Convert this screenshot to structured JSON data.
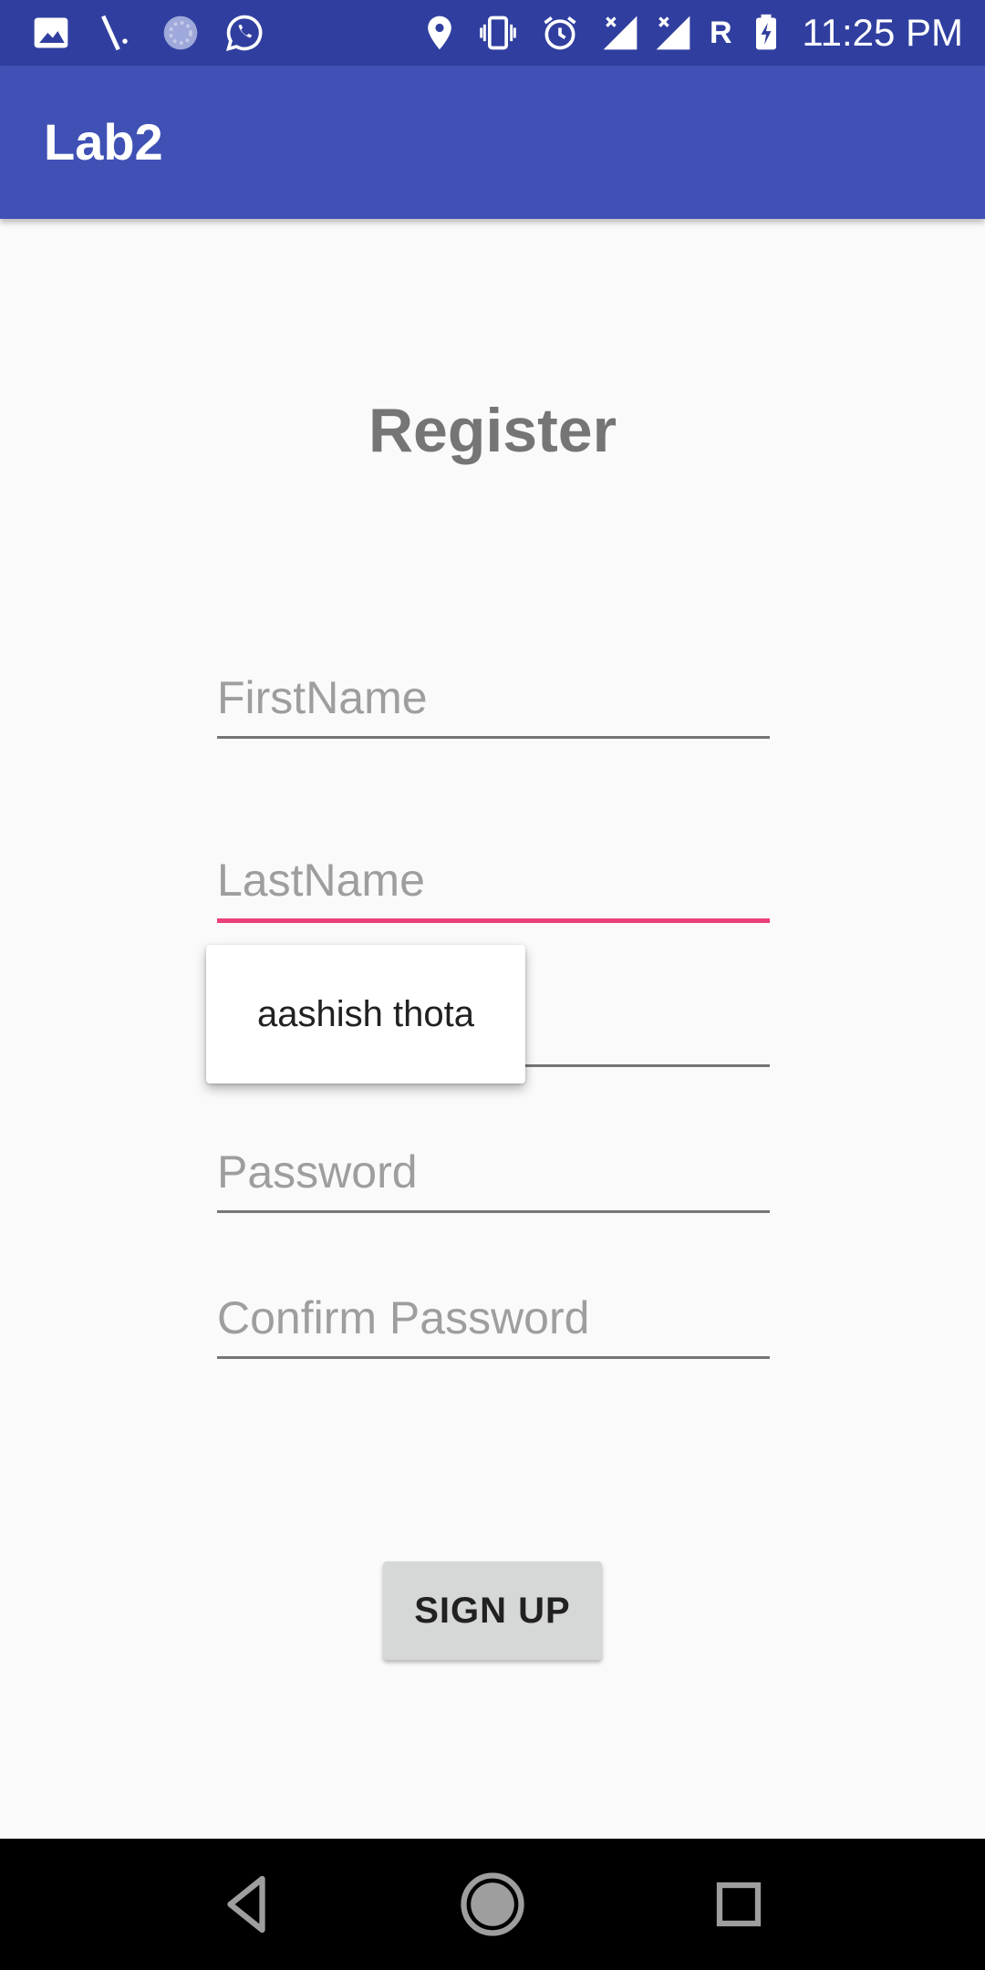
{
  "status_bar": {
    "time": "11:25 PM",
    "carrier_letter": "R",
    "icons": [
      "image-icon",
      "tool-icon",
      "sync-icon",
      "whatsapp-icon",
      "location-icon",
      "vibrate-icon",
      "alarm-icon",
      "signal-icon",
      "signal-icon",
      "battery-charging-icon"
    ]
  },
  "app_bar": {
    "title": "Lab2"
  },
  "form": {
    "title": "Register",
    "first_name_placeholder": "FirstName",
    "last_name_placeholder": "LastName",
    "email_placeholder": "",
    "password_placeholder": "Password",
    "confirm_password_placeholder": "Confirm Password",
    "signup_label": "SIGN UP"
  },
  "autocomplete": {
    "suggestion": "aashish thota"
  },
  "nav_bar": {
    "icons": [
      "back-icon",
      "home-icon",
      "recents-icon"
    ]
  },
  "colors": {
    "status_bar": "#303f9f",
    "app_bar": "#3f51b5",
    "focus_accent": "#ec407a"
  }
}
